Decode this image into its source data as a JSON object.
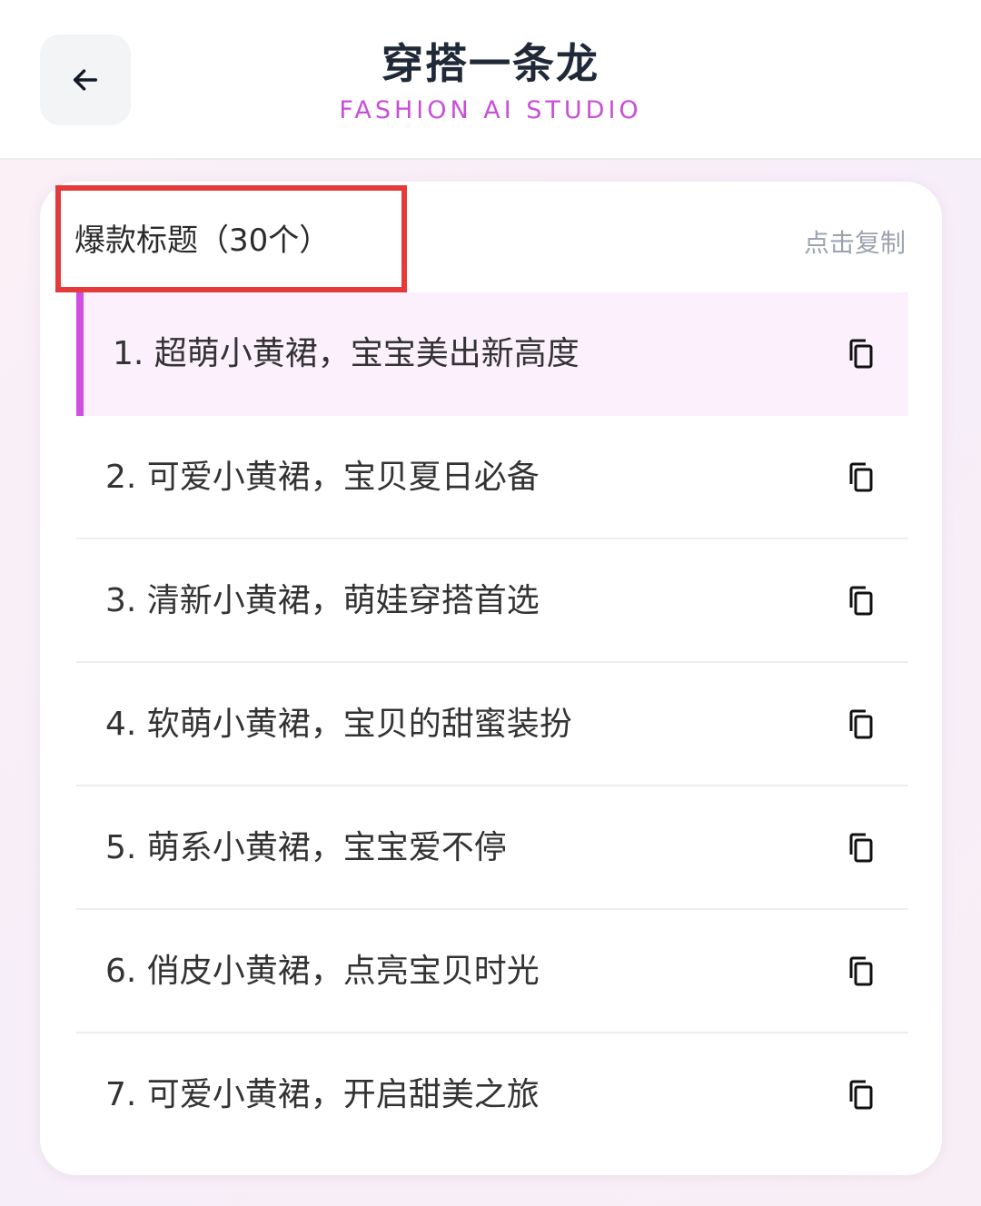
{
  "header": {
    "title": "穿搭一条龙",
    "subtitle": "FASHION AI STUDIO",
    "back_icon": "arrow-left-icon"
  },
  "section": {
    "title": "爆款标题（30个）",
    "copy_all_label": "点击复制"
  },
  "titles": [
    {
      "text": "1. 超萌小黄裙，宝宝美出新高度",
      "active": true
    },
    {
      "text": "2. 可爱小黄裙，宝贝夏日必备",
      "active": false
    },
    {
      "text": "3. 清新小黄裙，萌娃穿搭首选",
      "active": false
    },
    {
      "text": "4. 软萌小黄裙，宝贝的甜蜜装扮",
      "active": false
    },
    {
      "text": "5. 萌系小黄裙，宝宝爱不停",
      "active": false
    },
    {
      "text": "6. 俏皮小黄裙，点亮宝贝时光",
      "active": false
    },
    {
      "text": "7. 可爱小黄裙，开启甜美之旅",
      "active": false
    }
  ],
  "colors": {
    "accent": "#d04ee0",
    "subtitle": "#c84fd8",
    "highlight_border": "#e43a3a",
    "active_row_bg": "#fbf0fc"
  },
  "icons": {
    "copy": "copy-icon"
  }
}
